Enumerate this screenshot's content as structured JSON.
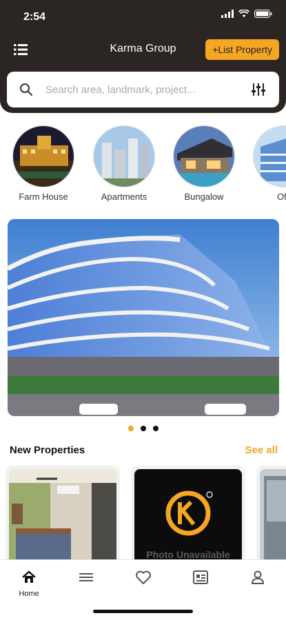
{
  "status_bar": {
    "time": "2:54"
  },
  "header": {
    "title": "Karma Group",
    "list_property": "+List Property"
  },
  "search": {
    "placeholder": "Search area, landmark, project..."
  },
  "categories": [
    {
      "label": "Farm House"
    },
    {
      "label": "Apartments"
    },
    {
      "label": "Bungalow"
    },
    {
      "label": "Offi"
    }
  ],
  "carousel": {
    "total": 3,
    "active_index": 0
  },
  "new_properties": {
    "title": "New Properties",
    "see_all": "See all",
    "cards": [
      {
        "kind": "photo"
      },
      {
        "kind": "placeholder",
        "placeholder_text": "Photo Unavailable"
      },
      {
        "kind": "photo"
      }
    ]
  },
  "bottom_nav": [
    {
      "label": "Home",
      "icon": "home-icon",
      "active": true
    },
    {
      "label": "",
      "icon": "menu-icon"
    },
    {
      "label": "",
      "icon": "heart-icon"
    },
    {
      "label": "",
      "icon": "listing-icon"
    },
    {
      "label": "",
      "icon": "profile-icon"
    }
  ],
  "colors": {
    "accent": "#f5a623",
    "header_bg": "#2b2624"
  }
}
